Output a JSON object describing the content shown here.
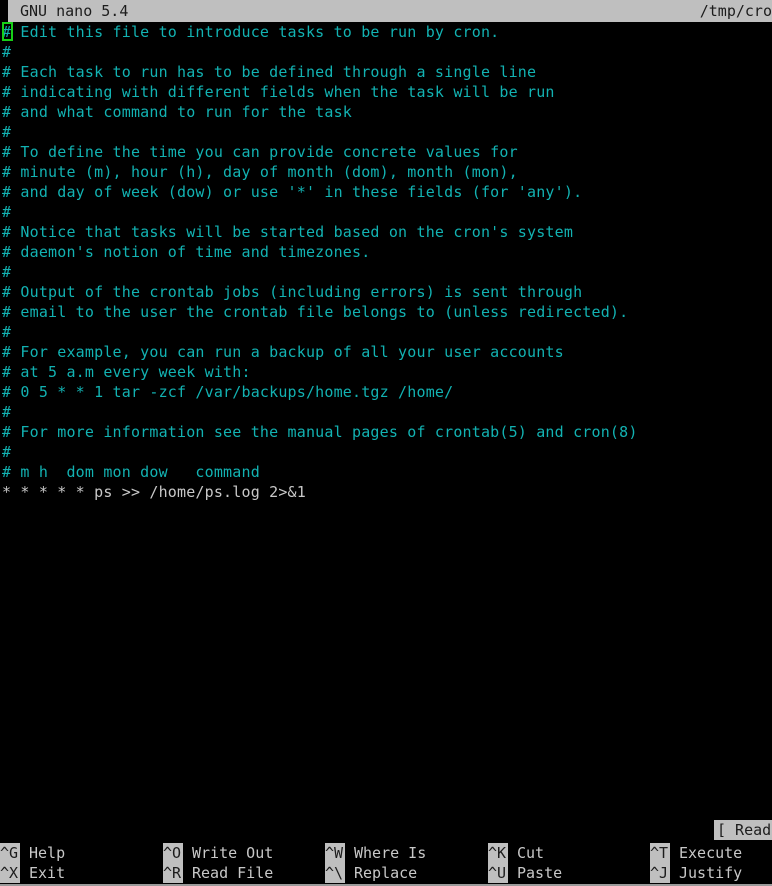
{
  "app": {
    "name": "GNU nano",
    "version": "5.4",
    "title": "GNU nano 5.4",
    "file_path": "/tmp/cro"
  },
  "titlebar": {
    "left_label": "GNU nano 5.4",
    "right_label": "/tmp/cro"
  },
  "editor": {
    "cursor": {
      "line": 1,
      "column": 1
    },
    "lines": [
      {
        "text": "# Edit this file to introduce tasks to be run by cron.",
        "style": "comment"
      },
      {
        "text": "#",
        "style": "comment"
      },
      {
        "text": "# Each task to run has to be defined through a single line",
        "style": "comment"
      },
      {
        "text": "# indicating with different fields when the task will be run",
        "style": "comment"
      },
      {
        "text": "# and what command to run for the task",
        "style": "comment"
      },
      {
        "text": "#",
        "style": "comment"
      },
      {
        "text": "# To define the time you can provide concrete values for",
        "style": "comment"
      },
      {
        "text": "# minute (m), hour (h), day of month (dom), month (mon),",
        "style": "comment"
      },
      {
        "text": "# and day of week (dow) or use '*' in these fields (for 'any').",
        "style": "comment"
      },
      {
        "text": "#",
        "style": "comment"
      },
      {
        "text": "# Notice that tasks will be started based on the cron's system",
        "style": "comment"
      },
      {
        "text": "# daemon's notion of time and timezones.",
        "style": "comment"
      },
      {
        "text": "#",
        "style": "comment"
      },
      {
        "text": "# Output of the crontab jobs (including errors) is sent through",
        "style": "comment"
      },
      {
        "text": "# email to the user the crontab file belongs to (unless redirected).",
        "style": "comment"
      },
      {
        "text": "#",
        "style": "comment"
      },
      {
        "text": "# For example, you can run a backup of all your user accounts",
        "style": "comment"
      },
      {
        "text": "# at 5 a.m every week with:",
        "style": "comment"
      },
      {
        "text": "# 0 5 * * 1 tar -zcf /var/backups/home.tgz /home/",
        "style": "comment"
      },
      {
        "text": "#",
        "style": "comment"
      },
      {
        "text": "# For more information see the manual pages of crontab(5) and cron(8)",
        "style": "comment"
      },
      {
        "text": "#",
        "style": "comment"
      },
      {
        "text": "# m h  dom mon dow   command",
        "style": "comment"
      },
      {
        "text": "* * * * * ps >> /home/ps.log 2>&1",
        "style": "plain"
      }
    ]
  },
  "status": {
    "message": "[ Read"
  },
  "shortcuts": {
    "row1": [
      {
        "key": "^G",
        "label": "Help"
      },
      {
        "key": "^O",
        "label": "Write Out"
      },
      {
        "key": "^W",
        "label": "Where Is"
      },
      {
        "key": "^K",
        "label": "Cut"
      },
      {
        "key": "^T",
        "label": "Execute"
      }
    ],
    "row2": [
      {
        "key": "^X",
        "label": "Exit"
      },
      {
        "key": "^R",
        "label": "Read File"
      },
      {
        "key": "^\\",
        "label": "Replace"
      },
      {
        "key": "^U",
        "label": "Paste"
      },
      {
        "key": "^J",
        "label": "Justify"
      }
    ]
  },
  "colors": {
    "background": "#000000",
    "comment_text": "#12b2b2",
    "plain_text": "#c8c8c8",
    "bar_background": "#bfbfbf",
    "bar_text": "#1c1c1c",
    "cursor_outline": "#17d017"
  }
}
